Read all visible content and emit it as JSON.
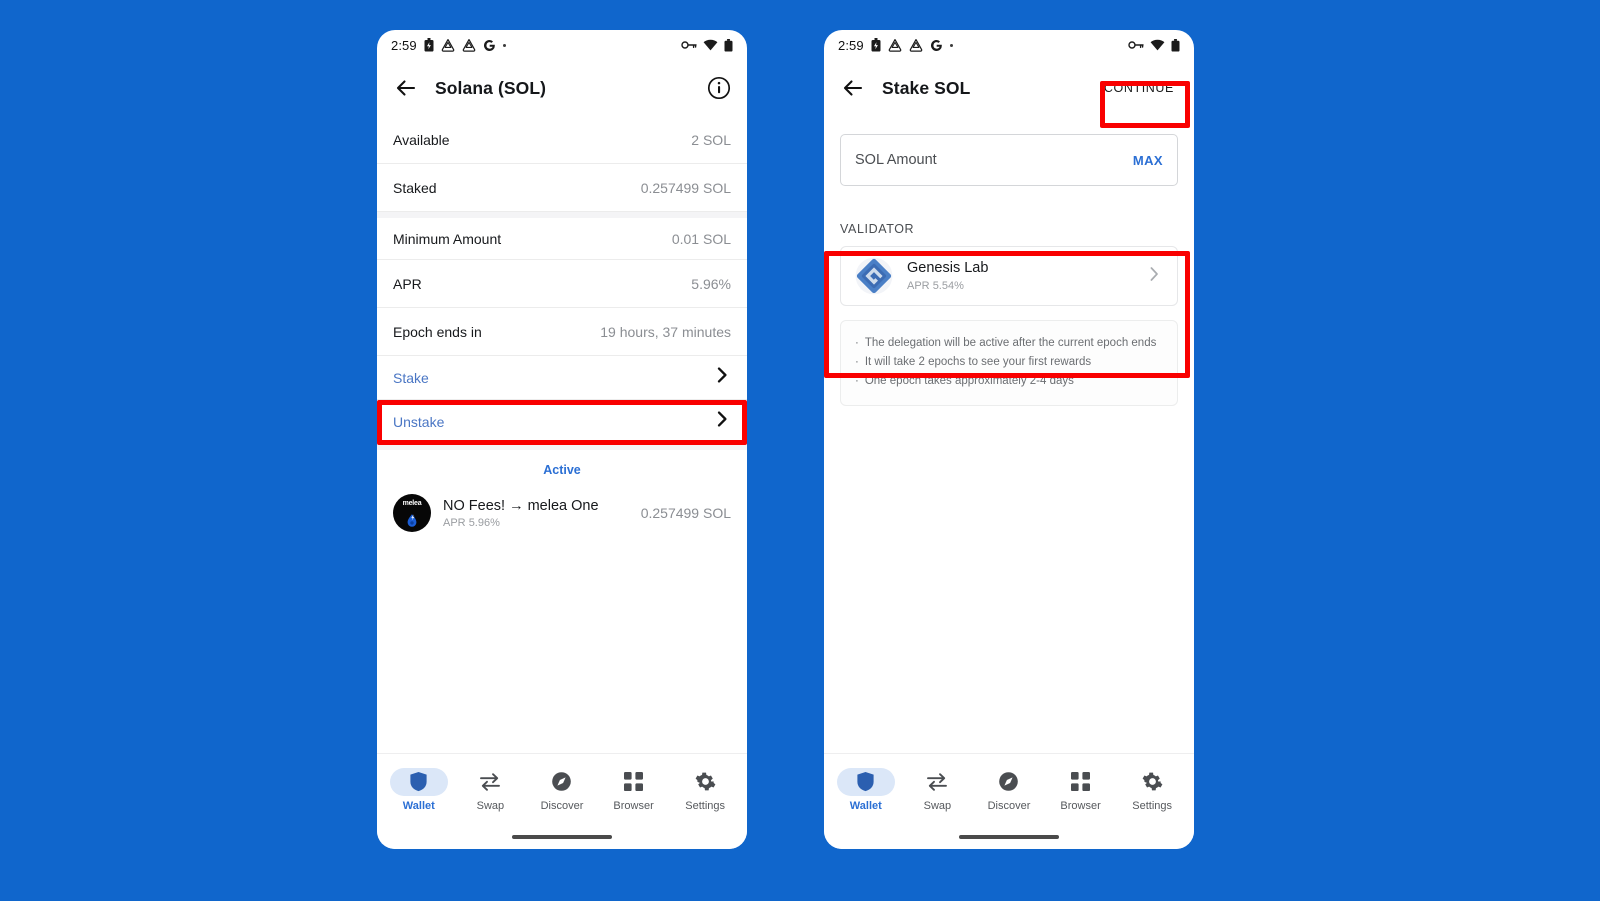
{
  "background_color": "#1066cc",
  "accent_color": "#2b6fd4",
  "highlight_color": "#f90000",
  "status_bar": {
    "time": "2:59",
    "left_icons": [
      "battery-saver-icon",
      "drive-icon",
      "drive-icon",
      "google-icon",
      "more-dot-icon"
    ],
    "right_icons": [
      "vpn-key-icon",
      "wifi-icon",
      "battery-icon"
    ]
  },
  "left_screen": {
    "appbar": {
      "back_icon": "back-arrow-icon",
      "title": "Solana (SOL)",
      "info_icon": "info-icon"
    },
    "details": [
      {
        "key": "Available",
        "value": "2 SOL"
      },
      {
        "key": "Staked",
        "value": "0.257499 SOL"
      },
      {
        "key": "Minimum Amount",
        "value": "0.01 SOL"
      },
      {
        "key": "APR",
        "value": "5.96%"
      },
      {
        "key": "Epoch ends in",
        "value": "19 hours, 37 minutes"
      }
    ],
    "actions": [
      {
        "label": "Stake",
        "name": "stake-row",
        "highlighted": true
      },
      {
        "label": "Unstake",
        "name": "unstake-row",
        "highlighted": false
      }
    ],
    "active_section": {
      "title": "Active",
      "items": [
        {
          "avatar_label": "melea",
          "name": "NO Fees! → melea One",
          "apr_label": "APR",
          "apr_value": "5.96%",
          "amount": "0.257499 SOL"
        }
      ]
    }
  },
  "right_screen": {
    "appbar": {
      "back_icon": "back-arrow-icon",
      "title": "Stake SOL",
      "continue_label": "CONTINUE"
    },
    "amount_field": {
      "placeholder": "SOL Amount",
      "value": "",
      "max_label": "MAX"
    },
    "validator_section": {
      "label": "VALIDATOR",
      "validator": {
        "name": "Genesis Lab",
        "apr_label": "APR",
        "apr_value": "5.54%",
        "chevron_icon": "chevron-right-icon"
      }
    },
    "notes": [
      "The delegation will be active after the current epoch ends",
      "It will take 2 epochs to see your first rewards",
      "One epoch takes approximately 2-4 days"
    ]
  },
  "bottom_nav": {
    "items": [
      {
        "label": "Wallet",
        "icon": "shield-icon",
        "active": true
      },
      {
        "label": "Swap",
        "icon": "swap-icon",
        "active": false
      },
      {
        "label": "Discover",
        "icon": "compass-icon",
        "active": false
      },
      {
        "label": "Browser",
        "icon": "grid-icon",
        "active": false
      },
      {
        "label": "Settings",
        "icon": "gear-icon",
        "active": false
      }
    ]
  }
}
